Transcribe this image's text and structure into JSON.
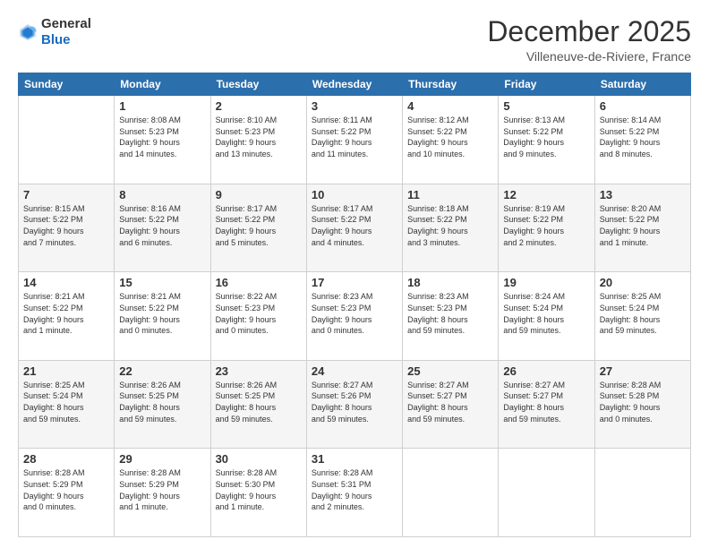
{
  "header": {
    "logo_general": "General",
    "logo_blue": "Blue",
    "month_title": "December 2025",
    "location": "Villeneuve-de-Riviere, France"
  },
  "calendar": {
    "columns": [
      "Sunday",
      "Monday",
      "Tuesday",
      "Wednesday",
      "Thursday",
      "Friday",
      "Saturday"
    ],
    "rows": [
      [
        {
          "day": "",
          "info": ""
        },
        {
          "day": "1",
          "info": "Sunrise: 8:08 AM\nSunset: 5:23 PM\nDaylight: 9 hours\nand 14 minutes."
        },
        {
          "day": "2",
          "info": "Sunrise: 8:10 AM\nSunset: 5:23 PM\nDaylight: 9 hours\nand 13 minutes."
        },
        {
          "day": "3",
          "info": "Sunrise: 8:11 AM\nSunset: 5:22 PM\nDaylight: 9 hours\nand 11 minutes."
        },
        {
          "day": "4",
          "info": "Sunrise: 8:12 AM\nSunset: 5:22 PM\nDaylight: 9 hours\nand 10 minutes."
        },
        {
          "day": "5",
          "info": "Sunrise: 8:13 AM\nSunset: 5:22 PM\nDaylight: 9 hours\nand 9 minutes."
        },
        {
          "day": "6",
          "info": "Sunrise: 8:14 AM\nSunset: 5:22 PM\nDaylight: 9 hours\nand 8 minutes."
        }
      ],
      [
        {
          "day": "7",
          "info": "Sunrise: 8:15 AM\nSunset: 5:22 PM\nDaylight: 9 hours\nand 7 minutes."
        },
        {
          "day": "8",
          "info": "Sunrise: 8:16 AM\nSunset: 5:22 PM\nDaylight: 9 hours\nand 6 minutes."
        },
        {
          "day": "9",
          "info": "Sunrise: 8:17 AM\nSunset: 5:22 PM\nDaylight: 9 hours\nand 5 minutes."
        },
        {
          "day": "10",
          "info": "Sunrise: 8:17 AM\nSunset: 5:22 PM\nDaylight: 9 hours\nand 4 minutes."
        },
        {
          "day": "11",
          "info": "Sunrise: 8:18 AM\nSunset: 5:22 PM\nDaylight: 9 hours\nand 3 minutes."
        },
        {
          "day": "12",
          "info": "Sunrise: 8:19 AM\nSunset: 5:22 PM\nDaylight: 9 hours\nand 2 minutes."
        },
        {
          "day": "13",
          "info": "Sunrise: 8:20 AM\nSunset: 5:22 PM\nDaylight: 9 hours\nand 1 minute."
        }
      ],
      [
        {
          "day": "14",
          "info": "Sunrise: 8:21 AM\nSunset: 5:22 PM\nDaylight: 9 hours\nand 1 minute."
        },
        {
          "day": "15",
          "info": "Sunrise: 8:21 AM\nSunset: 5:22 PM\nDaylight: 9 hours\nand 0 minutes."
        },
        {
          "day": "16",
          "info": "Sunrise: 8:22 AM\nSunset: 5:23 PM\nDaylight: 9 hours\nand 0 minutes."
        },
        {
          "day": "17",
          "info": "Sunrise: 8:23 AM\nSunset: 5:23 PM\nDaylight: 9 hours\nand 0 minutes."
        },
        {
          "day": "18",
          "info": "Sunrise: 8:23 AM\nSunset: 5:23 PM\nDaylight: 8 hours\nand 59 minutes."
        },
        {
          "day": "19",
          "info": "Sunrise: 8:24 AM\nSunset: 5:24 PM\nDaylight: 8 hours\nand 59 minutes."
        },
        {
          "day": "20",
          "info": "Sunrise: 8:25 AM\nSunset: 5:24 PM\nDaylight: 8 hours\nand 59 minutes."
        }
      ],
      [
        {
          "day": "21",
          "info": "Sunrise: 8:25 AM\nSunset: 5:24 PM\nDaylight: 8 hours\nand 59 minutes."
        },
        {
          "day": "22",
          "info": "Sunrise: 8:26 AM\nSunset: 5:25 PM\nDaylight: 8 hours\nand 59 minutes."
        },
        {
          "day": "23",
          "info": "Sunrise: 8:26 AM\nSunset: 5:25 PM\nDaylight: 8 hours\nand 59 minutes."
        },
        {
          "day": "24",
          "info": "Sunrise: 8:27 AM\nSunset: 5:26 PM\nDaylight: 8 hours\nand 59 minutes."
        },
        {
          "day": "25",
          "info": "Sunrise: 8:27 AM\nSunset: 5:27 PM\nDaylight: 8 hours\nand 59 minutes."
        },
        {
          "day": "26",
          "info": "Sunrise: 8:27 AM\nSunset: 5:27 PM\nDaylight: 8 hours\nand 59 minutes."
        },
        {
          "day": "27",
          "info": "Sunrise: 8:28 AM\nSunset: 5:28 PM\nDaylight: 9 hours\nand 0 minutes."
        }
      ],
      [
        {
          "day": "28",
          "info": "Sunrise: 8:28 AM\nSunset: 5:29 PM\nDaylight: 9 hours\nand 0 minutes."
        },
        {
          "day": "29",
          "info": "Sunrise: 8:28 AM\nSunset: 5:29 PM\nDaylight: 9 hours\nand 1 minute."
        },
        {
          "day": "30",
          "info": "Sunrise: 8:28 AM\nSunset: 5:30 PM\nDaylight: 9 hours\nand 1 minute."
        },
        {
          "day": "31",
          "info": "Sunrise: 8:28 AM\nSunset: 5:31 PM\nDaylight: 9 hours\nand 2 minutes."
        },
        {
          "day": "",
          "info": ""
        },
        {
          "day": "",
          "info": ""
        },
        {
          "day": "",
          "info": ""
        }
      ]
    ]
  }
}
